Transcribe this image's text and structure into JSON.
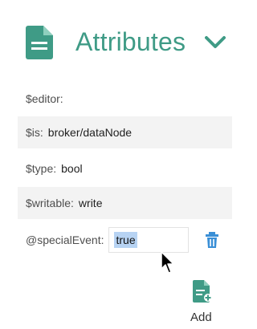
{
  "panel": {
    "title": "Attributes"
  },
  "attributes": [
    {
      "key": "$editor:",
      "value": ""
    },
    {
      "key": "$is:",
      "value": "broker/dataNode"
    },
    {
      "key": "$type:",
      "value": "bool"
    },
    {
      "key": "$writable:",
      "value": "write"
    },
    {
      "key": "@specialEvent:",
      "value": "true"
    }
  ],
  "actions": {
    "add_label": "Add"
  },
  "colors": {
    "accent": "#3f9b86",
    "action_blue": "#3a8fd6",
    "row_alt": "#f3f3f3",
    "selection": "#b7d3f3"
  },
  "icons": {
    "header": "document-icon",
    "collapse": "chevron-down-icon",
    "delete": "trash-icon",
    "add": "add-document-icon"
  }
}
